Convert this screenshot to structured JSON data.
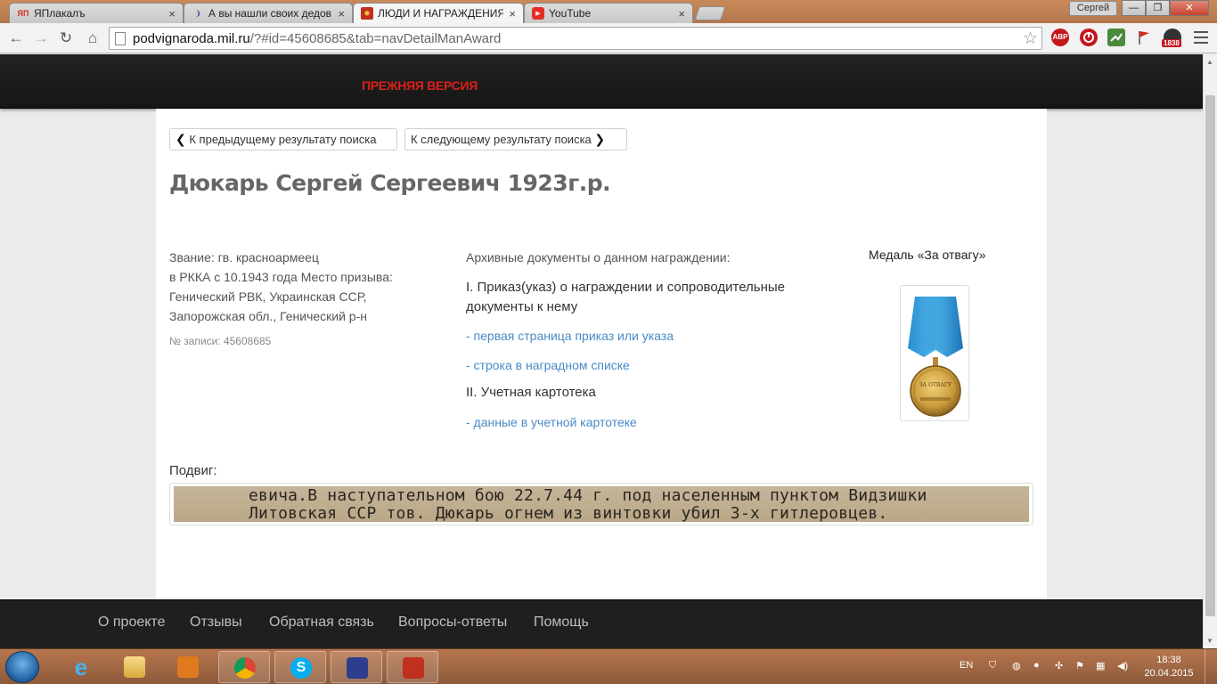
{
  "browser": {
    "tabs": [
      {
        "title": "ЯПлакалъ",
        "favicon_text": "ЯП",
        "favicon_color": "#d62b1f"
      },
      {
        "title": "А вы нашли своих дедов",
        "favicon_text": "❩",
        "favicon_color": "#3a4fb0"
      },
      {
        "title": "ЛЮДИ И НАГРАЖДЕНИЯ",
        "favicon_text": "✸",
        "favicon_color": "#c0301e"
      },
      {
        "title": "YouTube",
        "favicon_text": "▶",
        "favicon_color": "#e52d27"
      }
    ],
    "tab_close": "×",
    "user_button": "Сергей",
    "window_controls": {
      "minimize": "—",
      "maximize": "❐",
      "close": "✕"
    },
    "url_domain": "podvignaroda.mil.ru",
    "url_path": "/?#id=45608685&tab=navDetailManAward",
    "extensions": [
      {
        "name": "ABP",
        "color": "#c5161d"
      },
      {
        "name": "",
        "color": "#c5161d"
      },
      {
        "name": "",
        "color": "#4a8a3c"
      },
      {
        "name": "",
        "color": "#d62b1f"
      },
      {
        "name": "1838",
        "color": "#c5161d"
      }
    ]
  },
  "site": {
    "header_link": "ПРЕЖНЯЯ ВЕРСИЯ",
    "prev_result": "К предыдущему результату поиска",
    "next_result": "К следующему результату поиска",
    "person_name": "Дюкарь Сергей Сергеевич 1923г.р.",
    "info_lines": [
      "Звание: гв. красноармеец",
      "в РККА с 10.1943 года Место призыва:",
      "Генический РВК, Украинская ССР,",
      "Запорожская обл., Генический р-н"
    ],
    "record_number": "№ записи: 45608685",
    "archive_intro": "Архивные документы о данном награждении:",
    "section_1": "I. Приказ(указ) о награждении и сопроводительные документы к нему",
    "link_1": "- первая страница приказ или указа",
    "link_2": "- строка в наградном списке",
    "section_2": "II. Учетная картотека",
    "link_3": "- данные в учетной картотеке",
    "medal_title": "Медаль «За отвагу»",
    "medal_inscription": "ЗА ОТВАГУ",
    "feat_label": "Подвиг:",
    "feat_text_line_1": "евича.В наступательном бою 22.7.44 г. под населенным пунктом Видзишки",
    "feat_text_line_2": "Литовская ССР тов. Дюкарь огнем из винтовки убил 3-х гитлеровцев.",
    "footer_links": [
      "О проекте",
      "Отзывы",
      "Обратная связь",
      "Вопросы-ответы",
      "Помощь"
    ]
  },
  "taskbar": {
    "language": "EN",
    "time": "18:38",
    "date": "20.04.2015"
  }
}
